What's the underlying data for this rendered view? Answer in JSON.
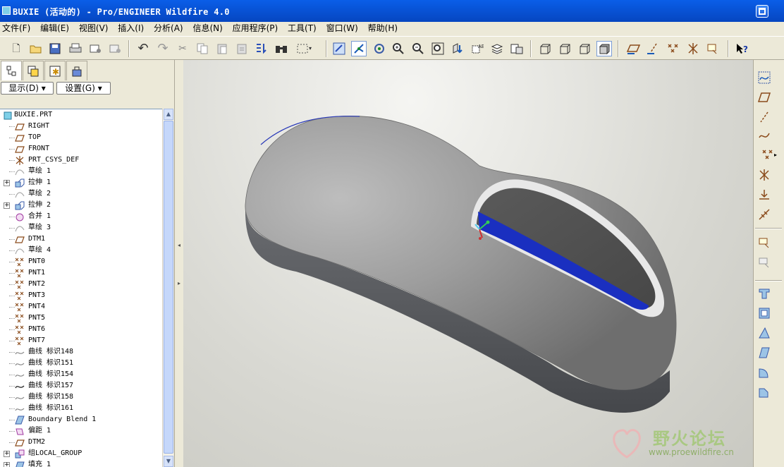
{
  "window": {
    "title": "BUXIE (活动的) - Pro/ENGINEER Wildfire 4.0"
  },
  "menu": [
    "文件(F)",
    "编辑(E)",
    "视图(V)",
    "插入(I)",
    "分析(A)",
    "信息(N)",
    "应用程序(P)",
    "工具(T)",
    "窗口(W)",
    "帮助(H)"
  ],
  "toolbar": {
    "icons": [
      "new-icon",
      "open-icon",
      "save-icon",
      "print-icon",
      "send-icon",
      "mail-icon",
      "undo-icon",
      "redo-icon",
      "cut-icon",
      "copy-icon",
      "paste-icon",
      "paste-special-icon",
      "regenerate-icon",
      "find-icon",
      "selection-box-icon",
      "repaint-icon",
      "spin-center-icon",
      "orient-icon",
      "zoom-in-icon",
      "zoom-out-icon",
      "refit-icon",
      "reorient-icon",
      "named-views-icon",
      "layers-icon",
      "appearance-icon",
      "wireframe-icon",
      "hidden-line-icon",
      "no-hidden-icon",
      "shading-icon",
      "datum-planes-icon",
      "datum-axes-icon",
      "datum-points-icon",
      "coord-sys-icon",
      "spin-center-toggle-icon",
      "context-help-icon"
    ]
  },
  "left_panel": {
    "tabs": [
      "model-tree-tab",
      "layer-tree-tab",
      "favorites-tab",
      "connections-tab"
    ],
    "show_button": "显示(D)",
    "settings_button": "设置(G)",
    "tree": {
      "root": "BUXIE.PRT",
      "items": [
        {
          "label": "RIGHT",
          "icon": "datum-plane"
        },
        {
          "label": "TOP",
          "icon": "datum-plane"
        },
        {
          "label": "FRONT",
          "icon": "datum-plane"
        },
        {
          "label": "PRT_CSYS_DEF",
          "icon": "csys"
        },
        {
          "label": "草绘 1",
          "icon": "sketch"
        },
        {
          "label": "拉伸 1",
          "icon": "extrude",
          "expandable": true
        },
        {
          "label": "草绘 2",
          "icon": "sketch"
        },
        {
          "label": "拉伸 2",
          "icon": "extrude",
          "expandable": true
        },
        {
          "label": "合并 1",
          "icon": "merge"
        },
        {
          "label": "草绘 3",
          "icon": "sketch"
        },
        {
          "label": "DTM1",
          "icon": "datum-plane"
        },
        {
          "label": "草绘 4",
          "icon": "sketch"
        },
        {
          "label": "PNT0",
          "icon": "datum-point"
        },
        {
          "label": "PNT1",
          "icon": "datum-point"
        },
        {
          "label": "PNT2",
          "icon": "datum-point"
        },
        {
          "label": "PNT3",
          "icon": "datum-point"
        },
        {
          "label": "PNT4",
          "icon": "datum-point"
        },
        {
          "label": "PNT5",
          "icon": "datum-point"
        },
        {
          "label": "PNT6",
          "icon": "datum-point"
        },
        {
          "label": "PNT7",
          "icon": "datum-point"
        },
        {
          "label": "曲线 标识148",
          "icon": "curve"
        },
        {
          "label": "曲线 标识151",
          "icon": "curve"
        },
        {
          "label": "曲线 标识154",
          "icon": "curve"
        },
        {
          "label": "曲线 标识157",
          "icon": "curve-active"
        },
        {
          "label": "曲线 标识158",
          "icon": "curve"
        },
        {
          "label": "曲线 标识161",
          "icon": "curve"
        },
        {
          "label": "Boundary Blend 1",
          "icon": "boundary-blend"
        },
        {
          "label": "偏距 1",
          "icon": "offset"
        },
        {
          "label": "DTM2",
          "icon": "datum-plane"
        },
        {
          "label": "组LOCAL_GROUP",
          "icon": "group",
          "expandable": true
        },
        {
          "label": "填充 1",
          "icon": "fill",
          "expandable": true
        }
      ]
    }
  },
  "right_toolbar": {
    "icons": [
      "sketched-curve-icon",
      "datum-plane-tool-icon",
      "datum-axis-tool-icon",
      "datum-curve-tool-icon",
      "datum-point-tool-icon",
      "coord-sys-tool-icon",
      "analysis-tool-icon",
      "reference-icon",
      "annotation-icon",
      "annotation-2-icon",
      "hole-icon",
      "shell-icon",
      "rib-icon",
      "draft-icon",
      "round-icon",
      "chamfer-icon"
    ]
  },
  "watermark": {
    "name": "野火论坛",
    "url": "www.proewildfire.cn"
  },
  "colors": {
    "title_bar": "#0a5ee8",
    "background": "#ece9d8",
    "model_body": "#8a8a8a",
    "highlight_face": "#1a2fc0"
  }
}
